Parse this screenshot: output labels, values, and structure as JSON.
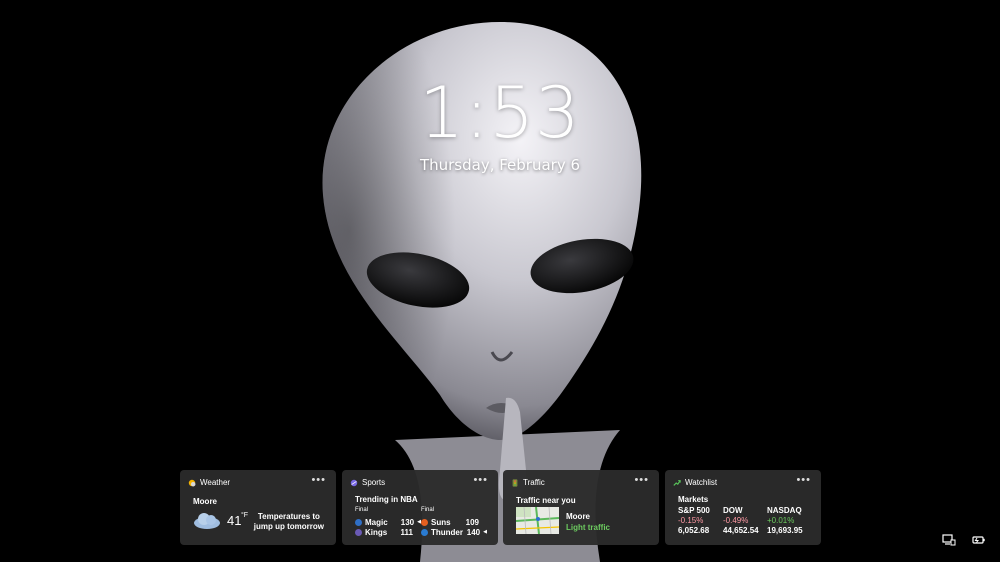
{
  "lock": {
    "time": "1:53",
    "date": "Thursday, February 6"
  },
  "weather": {
    "title": "Weather",
    "location": "Moore",
    "temp": "41",
    "unit": "°F",
    "forecast_line1": "Temperatures to",
    "forecast_line2": "jump up tomorrow"
  },
  "sports": {
    "title": "Sports",
    "heading": "Trending in NBA",
    "games": [
      {
        "status": "Final",
        "team1": {
          "name": "Magic",
          "score": "130"
        },
        "team2": {
          "name": "Kings",
          "score": "111"
        }
      },
      {
        "status": "Final",
        "team1": {
          "name": "Suns",
          "score": "109"
        },
        "team2": {
          "name": "Thunder",
          "score": "140"
        }
      }
    ]
  },
  "traffic": {
    "title": "Traffic",
    "heading": "Traffic near you",
    "location": "Moore",
    "status": "Light traffic"
  },
  "watchlist": {
    "title": "Watchlist",
    "heading": "Markets",
    "indices": [
      {
        "name": "S&P 500",
        "change": "-0.15%",
        "value": "6,052.68"
      },
      {
        "name": "DOW",
        "change": "-0.49%",
        "value": "44,652.54"
      },
      {
        "name": "NASDAQ",
        "change": "+0.01%",
        "value": "19,693.95"
      }
    ]
  },
  "more_label": "•••",
  "colors": {
    "positive": "#6ccb5f",
    "negative": "#ff99a4",
    "traffic_status": "#6ccb5f",
    "widget_bg": "#2b2b2b"
  },
  "icons": [
    "sun-icon",
    "sports-icon",
    "traffic-icon",
    "stocks-icon",
    "cloud-icon",
    "network-icon",
    "battery-icon",
    "more-icon"
  ]
}
